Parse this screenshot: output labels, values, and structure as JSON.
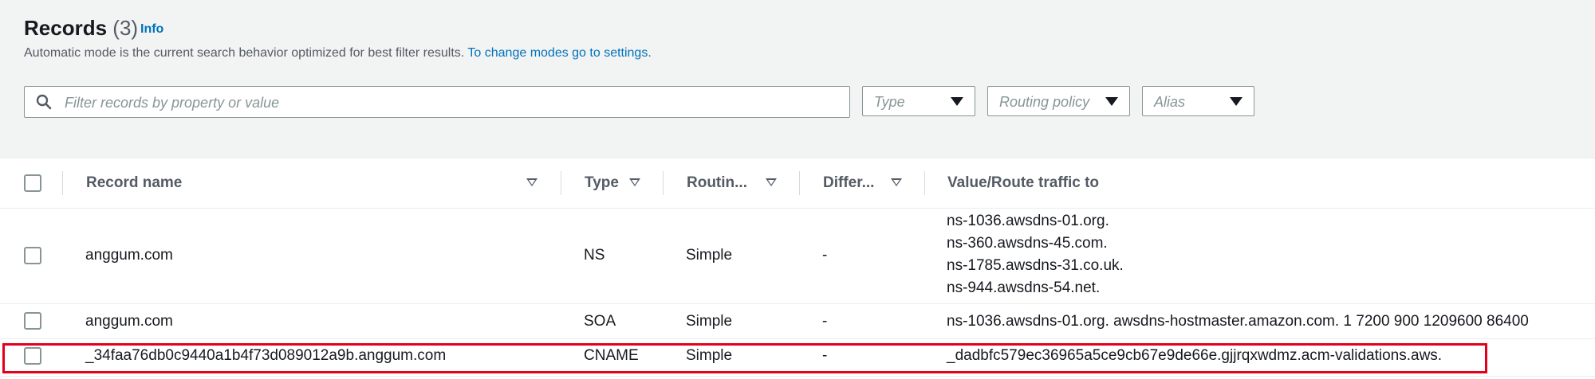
{
  "header": {
    "title": "Records",
    "count": "(3)",
    "info_link": "Info",
    "description": "Automatic mode is the current search behavior optimized for best filter results.",
    "settings_link": "To change modes go to settings."
  },
  "filters": {
    "search_placeholder": "Filter records by property or value",
    "type_label": "Type",
    "routing_policy_label": "Routing policy",
    "alias_label": "Alias"
  },
  "table": {
    "columns": [
      "Record name",
      "Type",
      "Routin...",
      "Differ...",
      "Value/Route traffic to"
    ],
    "rows": [
      {
        "name": "anggum.com",
        "type": "NS",
        "routing": "Simple",
        "differ": "-",
        "values": [
          "ns-1036.awsdns-01.org.",
          "ns-360.awsdns-45.com.",
          "ns-1785.awsdns-31.co.uk.",
          "ns-944.awsdns-54.net."
        ]
      },
      {
        "name": "anggum.com",
        "type": "SOA",
        "routing": "Simple",
        "differ": "-",
        "values": [
          "ns-1036.awsdns-01.org. awsdns-hostmaster.amazon.com. 1 7200 900 1209600 86400"
        ]
      },
      {
        "name": "_34faa76db0c9440a1b4f73d089012a9b.anggum.com",
        "type": "CNAME",
        "routing": "Simple",
        "differ": "-",
        "values": [
          "_dadbfc579ec36965a5ce9cb67e9de66e.gjjrqxwdmz.acm-validations.aws."
        ]
      }
    ]
  },
  "colors": {
    "link": "#0073bb",
    "highlight": "#e3001b"
  }
}
